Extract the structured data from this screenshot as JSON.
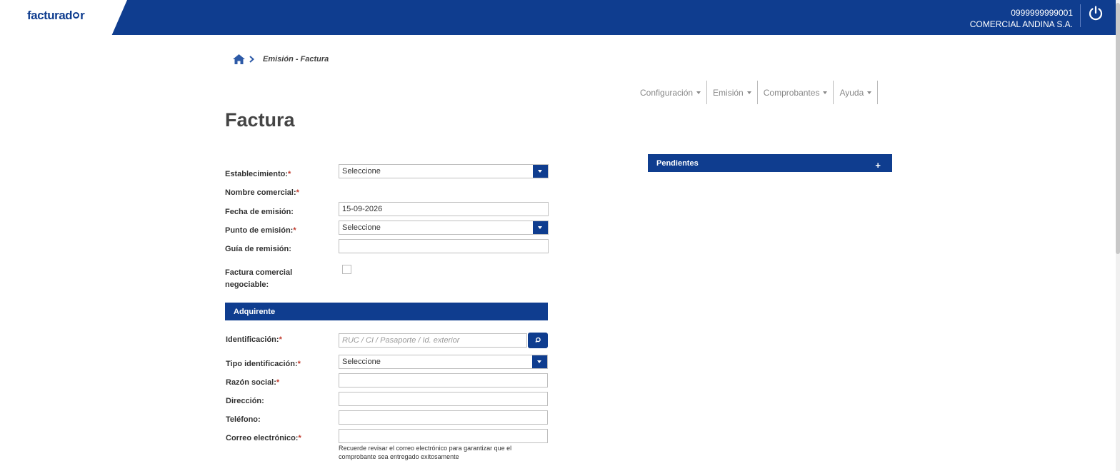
{
  "header": {
    "logo_text_pre": "facturad",
    "logo_text_post": "r",
    "ruc": "0999999999001",
    "company": "COMERCIAL ANDINA S.A."
  },
  "breadcrumb": {
    "text": "Emisión - Factura"
  },
  "menu": [
    {
      "label": "Configuración"
    },
    {
      "label": "Emisión"
    },
    {
      "label": "Comprobantes"
    },
    {
      "label": "Ayuda"
    }
  ],
  "page": {
    "title": "Factura"
  },
  "form": {
    "establecimiento_label": "Establecimiento:",
    "establecimiento_value": "Seleccione",
    "nombre_comercial_label": "Nombre comercial:",
    "fecha_label": "Fecha de emisión:",
    "fecha_value": "15-09-2026",
    "punto_label": "Punto de emisión:",
    "punto_value": "Seleccione",
    "guia_label": "Guía de remisión:",
    "guia_value": "",
    "factura_comercial_label_1": "Factura comercial",
    "factura_comercial_label_2": "negociable:"
  },
  "adquirente": {
    "section_title": "Adquirente",
    "identificacion_label": "Identificación:",
    "identificacion_placeholder": "RUC / CI / Pasaporte / Id. exterior",
    "tipo_label": "Tipo identificación:",
    "tipo_value": "Seleccione",
    "razon_label": "Razón social:",
    "razon_value": "",
    "direccion_label": "Dirección:",
    "direccion_value": "",
    "telefono_label": "Teléfono:",
    "telefono_value": "",
    "correo_label": "Correo electrónico:",
    "correo_value": "",
    "correo_note": "Recuerde revisar el correo electrónico para garantizar que el comprobante sea entregado exitosamente"
  },
  "pendientes": {
    "title": "Pendientes",
    "expand_symbol": "+"
  },
  "required_mark": "*",
  "colors": {
    "brand": "#0f3d8f",
    "required": "#c0392b"
  }
}
